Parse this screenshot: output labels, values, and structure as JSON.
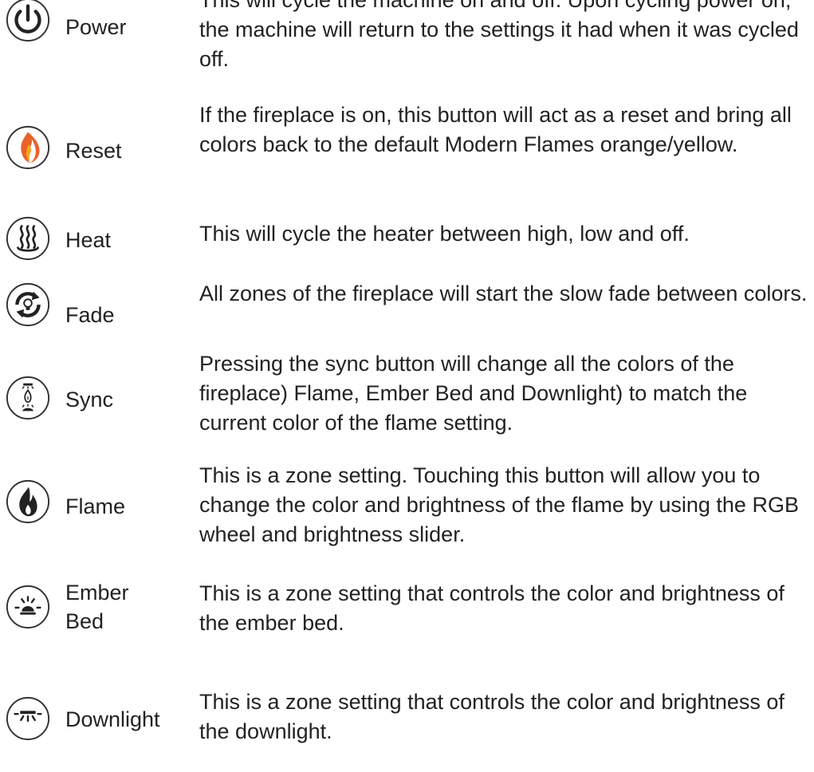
{
  "items": [
    {
      "label": "Power",
      "icon": "power-icon",
      "description": "This will cycle the machine on and off. Upon cycling power on, the machine will return to the settings it had when it was cycled off."
    },
    {
      "label": "Reset",
      "icon": "flame-reset-icon",
      "description": "If the fireplace is on, this button will act as a reset and bring all colors back to the default Modern Flames orange/yellow."
    },
    {
      "label": "Heat",
      "icon": "heat-icon",
      "description": "This will cycle the heater between high, low and off."
    },
    {
      "label": "Fade",
      "icon": "fade-icon",
      "description": "All zones of the fireplace will start the slow fade between colors."
    },
    {
      "label": "Sync",
      "icon": "sync-icon",
      "description": "Pressing the sync button will change all the colors of the fireplace) Flame, Ember Bed and Downlight) to match the current color of the flame setting."
    },
    {
      "label": "Flame",
      "icon": "flame-icon",
      "description": "This is a zone setting. Touching this button will allow you to change the color and brightness of the flame by using the RGB wheel and brightness slider."
    },
    {
      "label": "Ember\nBed",
      "icon": "ember-bed-icon",
      "description": "This is a zone setting that controls the color and brightness of the ember bed."
    },
    {
      "label": "Downlight",
      "icon": "downlight-icon",
      "description": "This is a zone setting that controls the color and brightness of the downlight."
    }
  ],
  "colors": {
    "text": "#222222",
    "icon_stroke": "#333333",
    "reset_flame_outer": "#e8622a",
    "reset_flame_inner": "#f5a623"
  }
}
